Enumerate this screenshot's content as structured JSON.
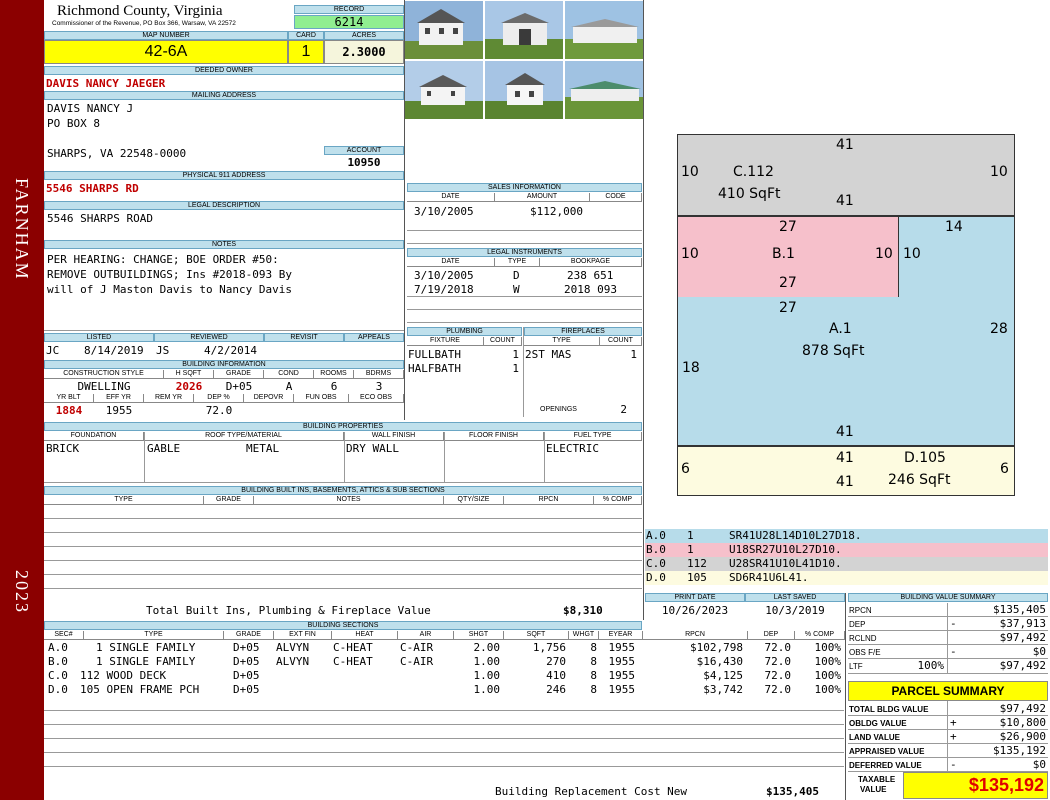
{
  "sidebar": {
    "district": "FARNHAM",
    "year": "2023"
  },
  "header": {
    "county": "Richmond County, Virginia",
    "commissioner": "Commissioner of the Revenue, PO Box 366, Warsaw, VA 22572",
    "record_label": "RECORD",
    "record": "6214",
    "map_label": "MAP NUMBER",
    "map": "42-6A",
    "card_label": "CARD",
    "card": "1",
    "acres_label": "ACRES",
    "acres": "2.3000"
  },
  "owner": {
    "deeded_label": "DEEDED OWNER",
    "deeded": "DAVIS NANCY JAEGER",
    "mailing_label": "MAILING ADDRESS",
    "mail1": "DAVIS NANCY J",
    "mail2": "PO BOX 8",
    "mail3": "SHARPS, VA 22548-0000",
    "account_label": "ACCOUNT",
    "account": "10950",
    "phys_label": "PHYSICAL 911 ADDRESS",
    "phys": "5546 SHARPS RD",
    "legal_label": "LEGAL DESCRIPTION",
    "legal": "5546 SHARPS ROAD",
    "notes_label": "NOTES",
    "note1": "PER HEARING: CHANGE; BOE ORDER #50:",
    "note2": "REMOVE OUTBUILDINGS; Ins #2018-093 By",
    "note3": "will of J Maston Davis to Nancy Davis"
  },
  "review": {
    "listed_label": "LISTED",
    "reviewed_label": "REVIEWED",
    "revisit_label": "REVISIT",
    "appeals_label": "APPEALS",
    "listed_by": "JC",
    "listed": "8/14/2019",
    "reviewed_by": "JS",
    "reviewed": "4/2/2014"
  },
  "building_info": {
    "title": "BUILDING INFORMATION",
    "h_style": "CONSTRUCTION STYLE",
    "h_sqft": "H SQFT",
    "h_grade": "GRADE",
    "h_cond": "COND",
    "h_rooms": "ROOMS",
    "h_bdrms": "BDRMS",
    "style": "DWELLING",
    "sqft": "2026",
    "grade": "D+05",
    "cond": "A",
    "rooms": "6",
    "bdrms": "3",
    "h_yrblt": "YR BLT",
    "h_effyr": "EFF YR",
    "h_remyr": "REM YR",
    "h_dep": "DEP %",
    "h_depovr": "DEPOVR",
    "h_funobs": "FUN OBS",
    "h_ecoobs": "ECO OBS",
    "yrblt": "1884",
    "effyr": "1955",
    "dep": "72.0"
  },
  "sales": {
    "title": "SALES INFORMATION",
    "h_date": "DATE",
    "h_amount": "AMOUNT",
    "h_code": "CODE",
    "date": "3/10/2005",
    "amount": "$112,000"
  },
  "legal_instruments": {
    "title": "LEGAL INSTRUMENTS",
    "h_date": "DATE",
    "h_type": "TYPE",
    "h_bookpage": "BOOKPAGE",
    "rows": [
      {
        "date": "3/10/2005",
        "type": "D",
        "book": "238 651"
      },
      {
        "date": "7/19/2018",
        "type": "W",
        "book": "2018 093"
      }
    ]
  },
  "plumbing": {
    "title": "PLUMBING",
    "h_fixture": "FIXTURE",
    "h_count": "COUNT",
    "rows": [
      {
        "fixture": "FULLBATH",
        "count": "1"
      },
      {
        "fixture": "HALFBATH",
        "count": "1"
      }
    ]
  },
  "fireplaces": {
    "title": "FIREPLACES",
    "h_type": "TYPE",
    "h_count": "COUNT",
    "type": "2ST MAS",
    "count": "1",
    "openings_label": "OPENINGS",
    "openings": "2"
  },
  "properties": {
    "title": "BUILDING PROPERTIES",
    "h_foundation": "FOUNDATION",
    "h_roof": "ROOF TYPE/MATERIAL",
    "h_wall": "WALL FINISH",
    "h_floor": "FLOOR FINISH",
    "h_fuel": "FUEL TYPE",
    "foundation": "BRICK",
    "roof_type": "GABLE",
    "roof_mat": "METAL",
    "wall": "DRY WALL",
    "fuel": "ELECTRIC"
  },
  "builtins": {
    "title": "BUILDING BUILT INS, BASEMENTS, ATTICS & SUB SECTIONS",
    "h_type": "TYPE",
    "h_grade": "GRADE",
    "h_notes": "NOTES",
    "h_qty": "QTY/SIZE",
    "h_rpcn": "RPCN",
    "h_comp": "% COMP",
    "total_label": "Total Built Ins, Plumbing & Fireplace Value",
    "total": "$8,310"
  },
  "sketch": {
    "c_label": "C.112",
    "c_area": "410 SqFt",
    "b_label": "B.1",
    "a_label": "A.1",
    "a_area": "878 SqFt",
    "d_label": "D.105",
    "d_area": "246 SqFt",
    "n41": "41",
    "n10": "10",
    "n27": "27",
    "n14": "14",
    "n28": "28",
    "n18": "18",
    "n6": "6"
  },
  "sketch_legend": [
    {
      "sec": "A.0",
      "code": "1",
      "path": "SR41U28L14D10L27D18.",
      "color": "#b7dcea"
    },
    {
      "sec": "B.0",
      "code": "1",
      "path": "U18SR27U10L27D10.",
      "color": "#f6c0cb"
    },
    {
      "sec": "C.0",
      "code": "112",
      "path": "U28SR41U10L41D10.",
      "color": "#d3d3d3"
    },
    {
      "sec": "D.0",
      "code": "105",
      "path": "SD6R41U6L41.",
      "color": "#fdfbe0"
    }
  ],
  "dates": {
    "print_label": "PRINT DATE",
    "print": "10/26/2023",
    "saved_label": "LAST SAVED",
    "saved": "10/3/2019"
  },
  "sections": {
    "title": "BUILDING SECTIONS",
    "h": {
      "sec": "SEC#",
      "type": "TYPE",
      "grade": "GRADE",
      "ext": "EXT FIN",
      "heat": "HEAT",
      "air": "AIR",
      "shgt": "SHGT",
      "sqft": "SQFT",
      "whgt": "WHGT",
      "eyear": "EYEAR",
      "rpcn": "RPCN",
      "dep": "DEP",
      "comp": "% COMP"
    },
    "rows": [
      {
        "sec": "A.0",
        "type": "1 SINGLE FAMILY",
        "grade": "D+05",
        "ext": "ALVYN",
        "heat": "C-HEAT",
        "air": "C-AIR",
        "shgt": "2.00",
        "sqft": "1,756",
        "whgt": "8",
        "eyear": "1955",
        "rpcn": "$102,798",
        "dep": "72.0",
        "comp": "100%"
      },
      {
        "sec": "B.0",
        "type": "1 SINGLE FAMILY",
        "grade": "D+05",
        "ext": "ALVYN",
        "heat": "C-HEAT",
        "air": "C-AIR",
        "shgt": "1.00",
        "sqft": "270",
        "whgt": "8",
        "eyear": "1955",
        "rpcn": "$16,430",
        "dep": "72.0",
        "comp": "100%"
      },
      {
        "sec": "C.0",
        "type": "112 WOOD DECK",
        "grade": "D+05",
        "ext": "",
        "heat": "",
        "air": "",
        "shgt": "1.00",
        "sqft": "410",
        "whgt": "8",
        "eyear": "1955",
        "rpcn": "$4,125",
        "dep": "72.0",
        "comp": "100%"
      },
      {
        "sec": "D.0",
        "type": "105 OPEN FRAME PCH",
        "grade": "D+05",
        "ext": "",
        "heat": "",
        "air": "",
        "shgt": "1.00",
        "sqft": "246",
        "whgt": "8",
        "eyear": "1955",
        "rpcn": "$3,742",
        "dep": "72.0",
        "comp": "100%"
      }
    ],
    "replacement_label": "Building Replacement Cost New",
    "replacement": "$135,405"
  },
  "bvs": {
    "title": "BUILDING VALUE SUMMARY",
    "rpcn_label": "RPCN",
    "rpcn": "$135,405",
    "dep_label": "DEP",
    "dep_sign": "-",
    "dep": "$37,913",
    "rclnd_label": "RCLND",
    "rclnd": "$97,492",
    "obs_label": "OBS F/E",
    "obs_sign": "-",
    "obs": "$0",
    "ltf_label": "LTF",
    "ltf_pct": "100%",
    "ltf": "$97,492"
  },
  "parcel": {
    "title": "PARCEL SUMMARY",
    "bldg_label": "TOTAL BLDG VALUE",
    "bldg": "$97,492",
    "obldg_label": "OBLDG VALUE",
    "obldg_sign": "+",
    "obldg": "$10,800",
    "land_label": "LAND VALUE",
    "land_sign": "+",
    "land": "$26,900",
    "appr_label": "APPRAISED VALUE",
    "appr": "$135,192",
    "def_label": "DEFERRED VALUE",
    "def_sign": "-",
    "def": "$0",
    "taxable_label1": "TAXABLE",
    "taxable_label2": "VALUE",
    "taxable": "$135,192"
  }
}
